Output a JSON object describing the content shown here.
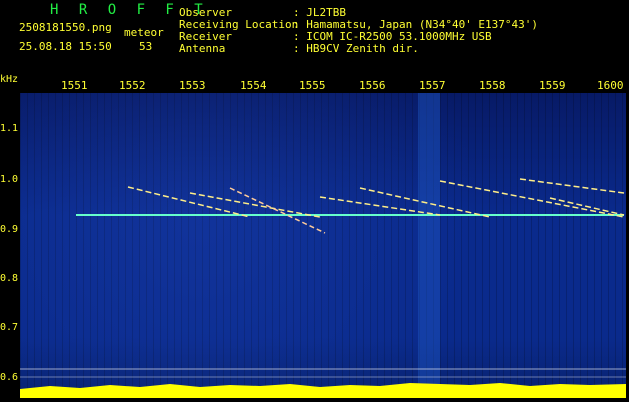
{
  "app": {
    "brand": "H R O F F T"
  },
  "file": {
    "name": "2508181550.png",
    "datetime": "25.08.18 15:50"
  },
  "meteor": {
    "label": "meteor",
    "count": "53"
  },
  "station": {
    "observer_label": "Observer",
    "observer": ": JL2TBB",
    "location_label": "Receiving Location",
    "location": ": Hamamatsu, Japan (N34°40' E137°43')",
    "receiver_label": "Receiver",
    "receiver": ": ICOM IC-R2500 53.1000MHz USB",
    "antenna_label": "Antenna",
    "antenna": ": HB9CV Zenith dir."
  },
  "axis": {
    "unit": "kHz",
    "y_ticks": [
      "1.1",
      "1.0",
      "0.9",
      "0.8",
      "0.7",
      "0.6"
    ],
    "x_ticks": [
      "1551",
      "1552",
      "1553",
      "1554",
      "1555",
      "1556",
      "1557",
      "1558",
      "1559",
      "1600"
    ]
  },
  "colors": {
    "text": "#ffff33",
    "brand": "#22ee44",
    "panel": "#0a2a8c",
    "echo_line": "#66ffcc",
    "meteor": "#ffee88",
    "bottom_bar": "#ffff00"
  }
}
